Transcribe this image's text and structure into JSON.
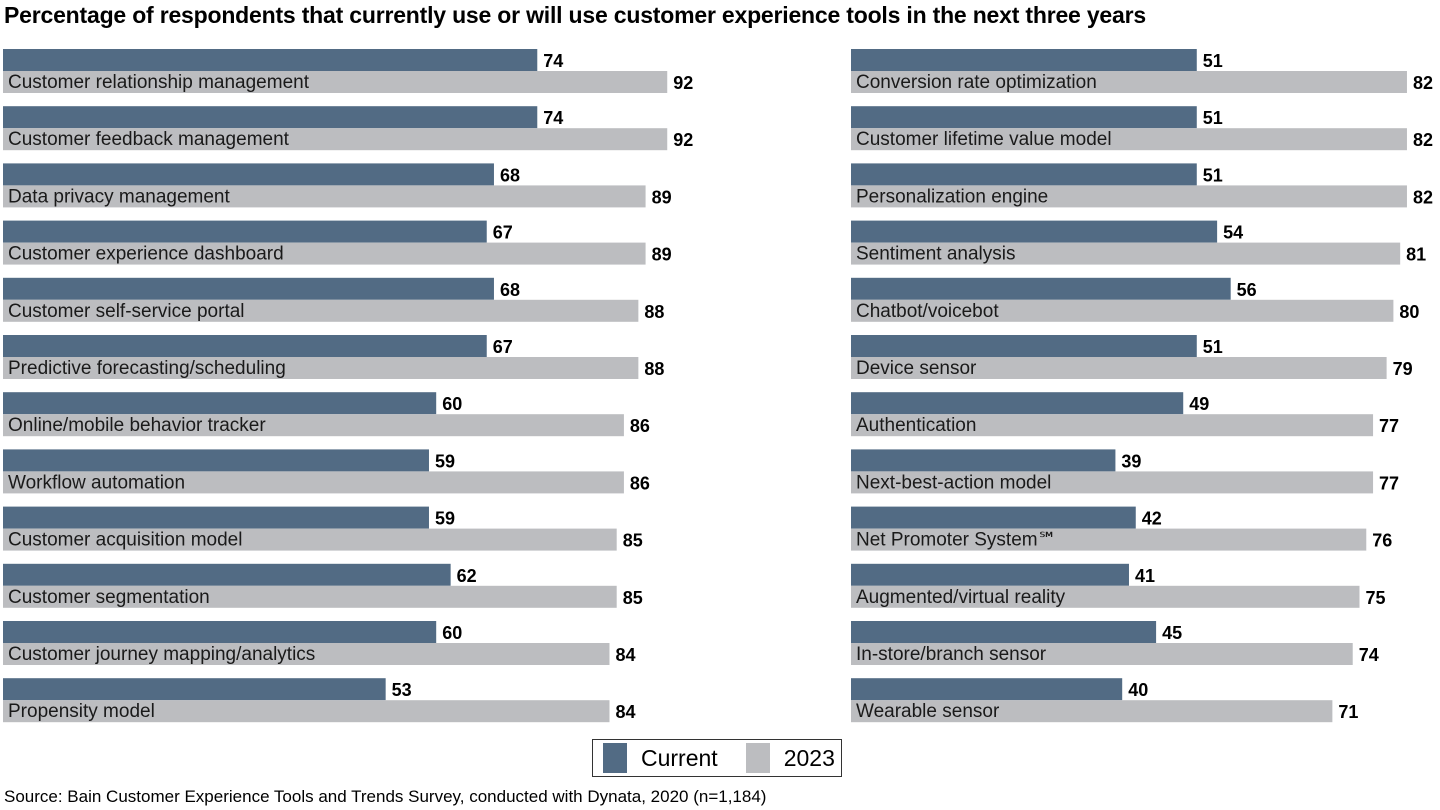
{
  "title": "Percentage of respondents that currently use or will use customer experience tools in the next three years",
  "legend": {
    "current": "Current",
    "future": "2023"
  },
  "colors": {
    "current": "#526b84",
    "future": "#bcbdc0"
  },
  "source": "Source: Bain Customer Experience Tools and Trends Survey, conducted with Dynata, 2020 (n=1,184)",
  "chart_data": {
    "type": "bar",
    "orientation": "horizontal",
    "title": "Percentage of respondents that currently use or will use customer experience tools in the next three years",
    "xlabel": "",
    "ylabel": "",
    "xlim": [
      0,
      100
    ],
    "grid": false,
    "legend_position": "bottom-center",
    "panels": [
      {
        "categories": [
          "Customer relationship management",
          "Customer feedback management",
          "Data privacy management",
          "Customer experience dashboard",
          "Customer self-service portal",
          "Predictive forecasting/scheduling",
          "Online/mobile behavior tracker",
          "Workflow automation",
          "Customer acquisition model",
          "Customer segmentation",
          "Customer journey mapping/analytics",
          "Propensity model"
        ],
        "series": [
          {
            "name": "Current",
            "values": [
              74,
              74,
              68,
              67,
              68,
              67,
              60,
              59,
              59,
              62,
              60,
              53
            ]
          },
          {
            "name": "2023",
            "values": [
              92,
              92,
              89,
              89,
              88,
              88,
              86,
              86,
              85,
              85,
              84,
              84
            ]
          }
        ]
      },
      {
        "categories": [
          "Conversion rate optimization",
          "Customer lifetime value model",
          "Personalization engine",
          "Sentiment analysis",
          "Chatbot/voicebot",
          "Device sensor",
          "Authentication",
          "Next-best-action model",
          "Net Promoter System℠",
          "Augmented/virtual reality",
          "In-store/branch sensor",
          "Wearable sensor"
        ],
        "series": [
          {
            "name": "Current",
            "values": [
              51,
              51,
              51,
              54,
              56,
              51,
              49,
              39,
              42,
              41,
              45,
              40
            ]
          },
          {
            "name": "2023",
            "values": [
              82,
              82,
              82,
              81,
              80,
              79,
              77,
              77,
              76,
              75,
              74,
              71
            ]
          }
        ]
      }
    ]
  }
}
